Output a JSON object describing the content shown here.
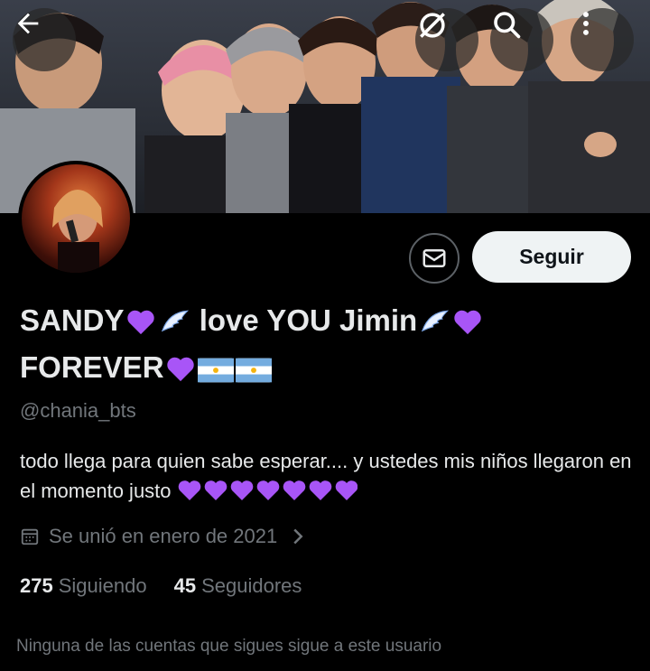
{
  "profile": {
    "display_name_part1": "SANDY",
    "display_name_part2": " love YOU Jimin",
    "display_name_part3": "FOREVER",
    "handle": "@chania_bts",
    "bio_text": "todo llega para quien sabe esperar....  y ustedes mis niños llegaron en el momento justo ",
    "joined": "Se unió en enero de 2021",
    "following_count": "275",
    "following_label": "Siguiendo",
    "followers_count": "45",
    "followers_label": "Seguidores",
    "mutuals_note": "Ninguna de las cuentas que sigues sigue a este usuario"
  },
  "actions": {
    "follow_label": "Seguir"
  },
  "icons": {
    "back": "arrow-left-icon",
    "unavailable": "circle-slash-icon",
    "search": "search-icon",
    "more": "more-vertical-icon",
    "message": "envelope-icon",
    "calendar": "calendar-icon",
    "heart": "purple-heart-emoji",
    "wing": "wing-emoji",
    "flag": "argentina-flag-emoji"
  },
  "colors": {
    "background": "#000000",
    "text_primary": "#e7e9ea",
    "text_secondary": "#71767b",
    "heart": "#a855f7",
    "follow_button_bg": "#eff3f4"
  }
}
